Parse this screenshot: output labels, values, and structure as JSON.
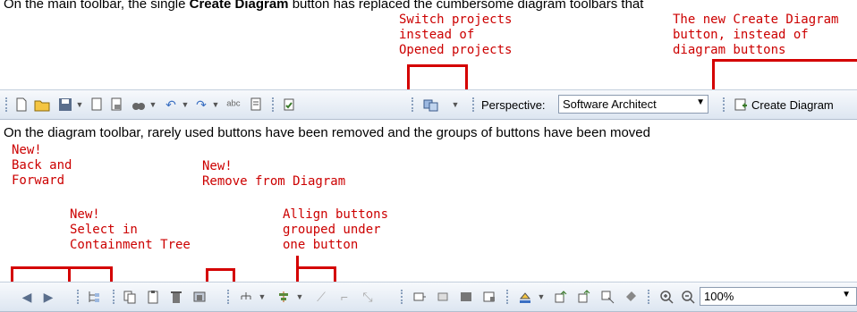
{
  "top_text": {
    "prefix": "On the main toolbar, the single ",
    "bold": "Create Diagram",
    "suffix": " button has replaced the cumbersome diagram toolbars that"
  },
  "annotations_top": {
    "switch_projects": "Switch projects\ninstead of\nOpened projects",
    "create_diagram_note": "The new Create Diagram\nbutton, instead of\ndiagram buttons"
  },
  "main_toolbar": {
    "perspective_label": "Perspective:",
    "perspective_value": "Software Architect",
    "create_diagram_label": "Create Diagram"
  },
  "middle_text": "On the diagram toolbar, rarely used buttons have been removed and the groups of buttons have been moved",
  "annotations_bottom": {
    "back_forward": "New!\nBack and\nForward",
    "select_tree": "New!\nSelect in\nContainment Tree",
    "remove_diagram": "New!\nRemove from Diagram",
    "align": "Allign buttons\ngrouped under\none button"
  },
  "diagram_toolbar": {
    "zoom_value": "100%"
  },
  "colors": {
    "accent": "#cc0000",
    "toolbar_top": "#f7f9fc",
    "toolbar_bottom": "#dde6f1"
  }
}
